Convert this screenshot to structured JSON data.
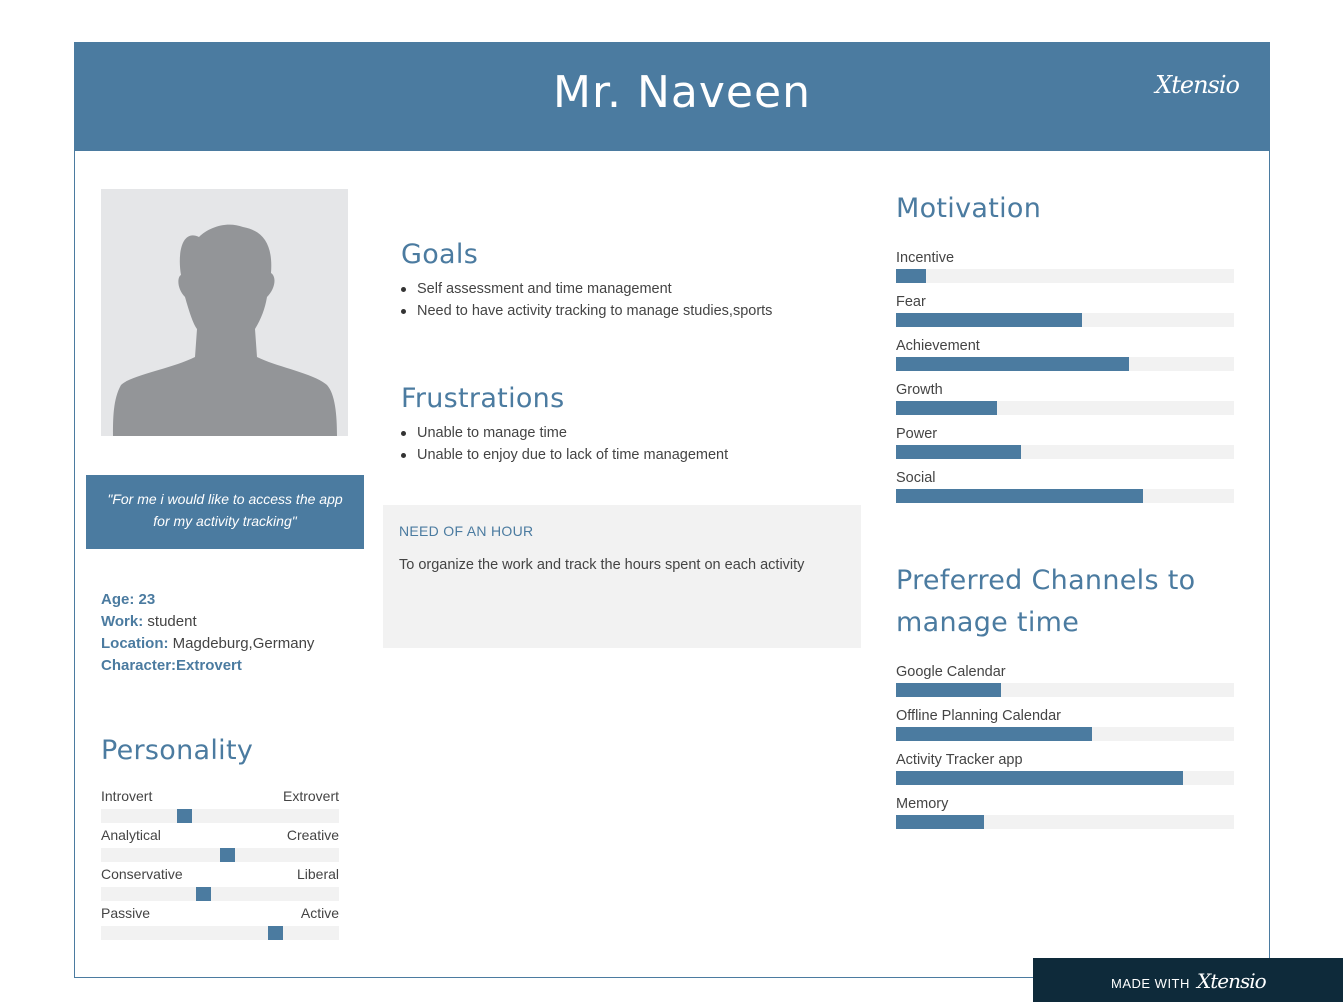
{
  "header": {
    "title": "Mr. Naveen",
    "logo": "Xtensio"
  },
  "profile": {
    "photo_icon": "person-silhouette-icon",
    "quote": "\"For me i would like to access the app for my activity tracking\"",
    "facts": [
      {
        "label": "Age:",
        "value": "23"
      },
      {
        "label": "Work:",
        "value": "student"
      },
      {
        "label": "Location:",
        "value": "Magdeburg,Germany"
      },
      {
        "label": "Character:Extrovert",
        "value": ""
      }
    ]
  },
  "personality": {
    "heading": "Personality",
    "scales": [
      {
        "left": "Introvert",
        "right": "Extrovert",
        "position": 0.35
      },
      {
        "left": "Analytical",
        "right": "Creative",
        "position": 0.53
      },
      {
        "left": "Conservative",
        "right": "Liberal",
        "position": 0.43
      },
      {
        "left": "Passive",
        "right": "Active",
        "position": 0.73
      }
    ]
  },
  "goals": {
    "heading": "Goals",
    "items": [
      "Self assessment and time management",
      "Need to have activity tracking to manage studies,sports"
    ]
  },
  "frustrations": {
    "heading": "Frustrations",
    "items": [
      "Unable to manage time",
      "Unable to enjoy due to lack of time management"
    ]
  },
  "need": {
    "heading": "NEED OF AN HOUR",
    "text": "To organize the work and track the hours spent on each activity"
  },
  "motivation": {
    "heading": "Motivation",
    "items": [
      {
        "label": "Incentive",
        "value": 0.09
      },
      {
        "label": "Fear",
        "value": 0.55
      },
      {
        "label": "Achievement",
        "value": 0.69
      },
      {
        "label": "Growth",
        "value": 0.3
      },
      {
        "label": "Power",
        "value": 0.37
      },
      {
        "label": "Social",
        "value": 0.73
      }
    ]
  },
  "channels": {
    "heading_line1": "Preferred Channels to",
    "heading_line2": "manage time",
    "items": [
      {
        "label": "Google Calendar",
        "value": 0.31
      },
      {
        "label": "Offline Planning Calendar",
        "value": 0.58
      },
      {
        "label": "Activity Tracker app",
        "value": 0.85
      },
      {
        "label": "Memory",
        "value": 0.26
      }
    ]
  },
  "footer": {
    "made_with": "MADE WITH",
    "logo": "Xtensio"
  },
  "colors": {
    "accent": "#4b7ba0",
    "track": "#f2f2f2",
    "footer": "#0e2a3a"
  }
}
